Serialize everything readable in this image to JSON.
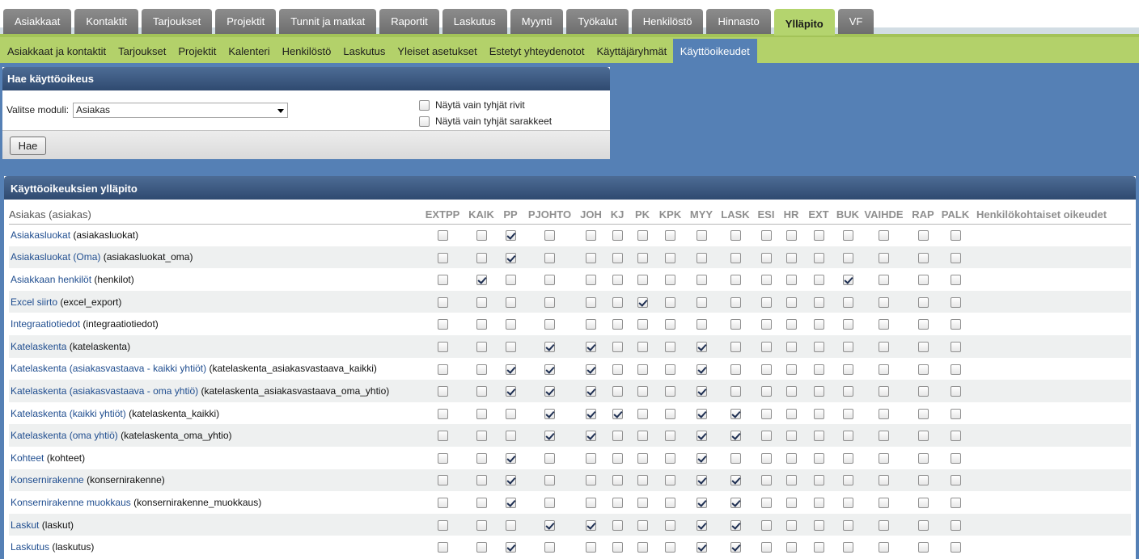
{
  "top_tabs": [
    "Asiakkaat",
    "Kontaktit",
    "Tarjoukset",
    "Projektit",
    "Tunnit ja matkat",
    "Raportit",
    "Laskutus",
    "Myynti",
    "Työkalut",
    "Henkilöstö",
    "Hinnasto",
    "Ylläpito",
    "VF"
  ],
  "top_tabs_active": "Ylläpito",
  "sub_nav": [
    "Asiakkaat ja kontaktit",
    "Tarjoukset",
    "Projektit",
    "Kalenteri",
    "Henkilöstö",
    "Laskutus",
    "Yleiset asetukset",
    "Estetyt yhteydenotot",
    "Käyttäjäryhmät",
    "Käyttöoikeudet"
  ],
  "sub_nav_active": "Käyttöoikeudet",
  "search": {
    "title": "Hae käyttöoikeus",
    "module_label": "Valitse moduli:",
    "module_value": "Asiakas",
    "option_empty_rows": "Näytä vain tyhjät rivit",
    "option_empty_cols": "Näytä vain tyhjät sarakkeet",
    "option_empty_rows_checked": false,
    "option_empty_cols_checked": false,
    "button": "Hae"
  },
  "permissions": {
    "title": "Käyttöoikeuksien ylläpito",
    "module_header": "Asiakas (asiakas)",
    "columns": [
      "EXTPP",
      "KAIK",
      "PP",
      "PJOHTO",
      "JOH",
      "KJ",
      "PK",
      "KPK",
      "MYY",
      "LASK",
      "ESI",
      "HR",
      "EXT",
      "BUK",
      "VAIHDE",
      "RAP",
      "PALK"
    ],
    "last_column": "Henkilökohtaiset oikeudet",
    "rows": [
      {
        "label": "Asiakasluokat",
        "key": "(asiakasluokat)",
        "checked": [
          "PP"
        ]
      },
      {
        "label": "Asiakasluokat (Oma)",
        "key": "(asiakasluokat_oma)",
        "checked": [
          "PP"
        ]
      },
      {
        "label": "Asiakkaan henkilöt",
        "key": "(henkilot)",
        "checked": [
          "KAIK",
          "BUK"
        ]
      },
      {
        "label": "Excel siirto",
        "key": "(excel_export)",
        "checked": [
          "PK"
        ]
      },
      {
        "label": "Integraatiotiedot",
        "key": "(integraatiotiedot)",
        "checked": []
      },
      {
        "label": "Katelaskenta",
        "key": "(katelaskenta)",
        "checked": [
          "PJOHTO",
          "JOH",
          "MYY"
        ]
      },
      {
        "label": "Katelaskenta (asiakasvastaava - kaikki yhtiöt)",
        "key": "(katelaskenta_asiakasvastaava_kaikki)",
        "checked": [
          "PP",
          "PJOHTO",
          "JOH",
          "MYY"
        ]
      },
      {
        "label": "Katelaskenta (asiakasvastaava - oma yhtiö)",
        "key": "(katelaskenta_asiakasvastaava_oma_yhtio)",
        "checked": [
          "PP",
          "PJOHTO",
          "JOH",
          "MYY"
        ]
      },
      {
        "label": "Katelaskenta (kaikki yhtiöt)",
        "key": "(katelaskenta_kaikki)",
        "checked": [
          "PJOHTO",
          "JOH",
          "KJ",
          "MYY",
          "LASK"
        ]
      },
      {
        "label": "Katelaskenta (oma yhtiö)",
        "key": "(katelaskenta_oma_yhtio)",
        "checked": [
          "PJOHTO",
          "JOH",
          "MYY",
          "LASK"
        ]
      },
      {
        "label": "Kohteet",
        "key": "(kohteet)",
        "checked": [
          "PP",
          "MYY"
        ]
      },
      {
        "label": "Konsernirakenne",
        "key": "(konsernirakenne)",
        "checked": [
          "PP",
          "MYY",
          "LASK"
        ]
      },
      {
        "label": "Konsernirakenne muokkaus",
        "key": "(konsernirakenne_muokkaus)",
        "checked": [
          "PP",
          "MYY",
          "LASK"
        ]
      },
      {
        "label": "Laskut",
        "key": "(laskut)",
        "checked": [
          "PJOHTO",
          "JOH",
          "MYY",
          "LASK"
        ]
      },
      {
        "label": "Laskutus",
        "key": "(laskutus)",
        "checked": [
          "PP",
          "MYY",
          "LASK"
        ]
      }
    ]
  }
}
